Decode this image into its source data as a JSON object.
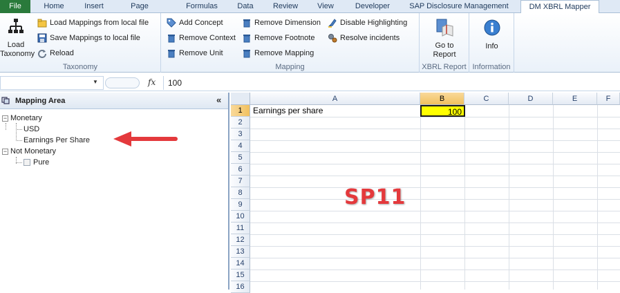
{
  "tabs": [
    {
      "label": "File"
    },
    {
      "label": "Home"
    },
    {
      "label": "Insert"
    },
    {
      "label": "Page Layout"
    },
    {
      "label": "Formulas"
    },
    {
      "label": "Data"
    },
    {
      "label": "Review"
    },
    {
      "label": "View"
    },
    {
      "label": "Developer"
    },
    {
      "label": "SAP Disclosure Management"
    },
    {
      "label": "DM XBRL Mapper"
    }
  ],
  "ribbon": {
    "taxonomy": {
      "label": "Taxonomy",
      "load_taxonomy": "Load\nTaxonomy",
      "load_mappings": "Load Mappings from local file",
      "save_mappings": "Save Mappings to local file",
      "reload": "Reload"
    },
    "mapping": {
      "label": "Mapping",
      "add_concept": "Add Concept",
      "remove_context": "Remove Context",
      "remove_unit": "Remove Unit",
      "remove_dimension": "Remove Dimension",
      "remove_footnote": "Remove Footnote",
      "remove_mapping": "Remove Mapping",
      "disable_highlighting": "Disable Highlighting",
      "resolve_incidents": "Resolve incidents"
    },
    "xbrl_report": {
      "label": "XBRL Report",
      "go_to_report": "Go to\nReport"
    },
    "information": {
      "label": "Information",
      "info": "Info"
    }
  },
  "formula_bar": {
    "fx": "fx",
    "value": "100"
  },
  "mapping_area": {
    "title": "Mapping Area",
    "collapse": "«",
    "tree": [
      {
        "label": "Monetary",
        "children": [
          "USD",
          "Earnings Per Share"
        ]
      },
      {
        "label": "Not Monetary",
        "children": [
          "Pure"
        ]
      }
    ]
  },
  "sheet": {
    "columns": [
      "A",
      "B",
      "C",
      "D",
      "E",
      "F"
    ],
    "rows": [
      "1",
      "2",
      "3",
      "4",
      "5",
      "6",
      "7",
      "8",
      "9",
      "10",
      "11",
      "12",
      "13",
      "14",
      "15",
      "16"
    ],
    "a1": "Earnings per share",
    "b1": "100"
  },
  "overlay": {
    "label": "SP11",
    "color": "#e4393c"
  },
  "colors": {
    "file_tab": "#2a7a3b",
    "highlight_cell": "#ffff00",
    "selected_header": "#f1c15f",
    "arrow": "#e4393c"
  }
}
